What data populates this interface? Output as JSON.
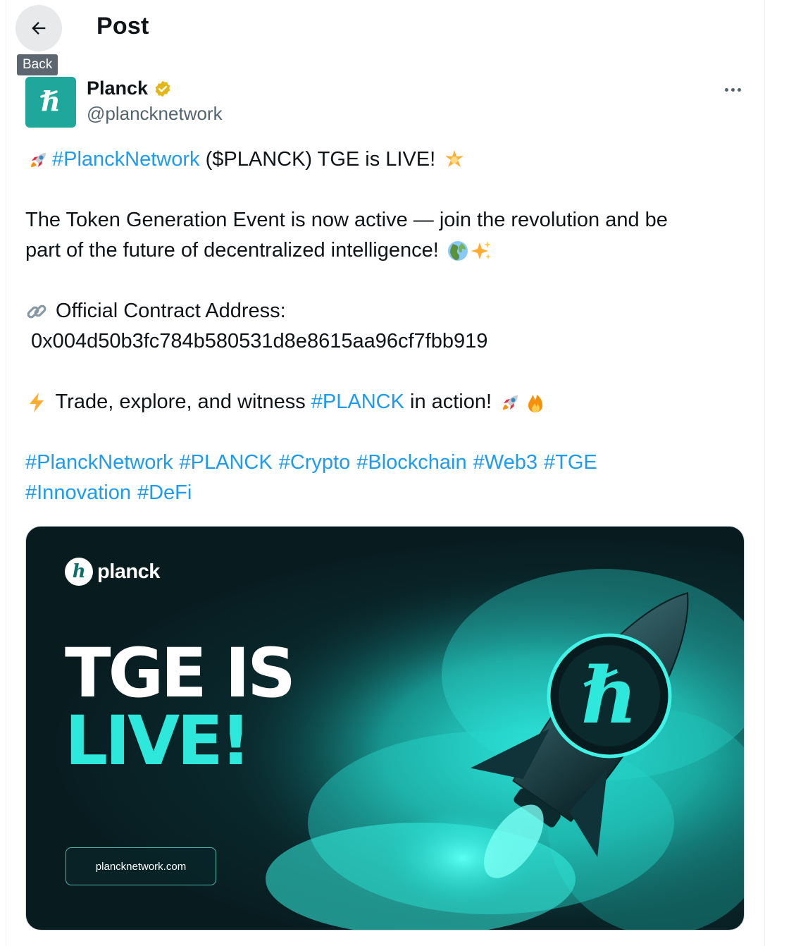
{
  "header": {
    "title": "Post",
    "back_tooltip": "Back"
  },
  "author": {
    "name": "Planck",
    "handle": "@plancknetwork",
    "verified": true,
    "avatar_glyph": "h",
    "avatar_color": "#1ea79a"
  },
  "post": {
    "line1": {
      "tag": "#PlanckNetwork",
      "text": " ($PLANCK) TGE is LIVE! "
    },
    "line2": "The Token Generation Event is now active — join the revolution and be",
    "line3": "part of the future of decentralized intelligence! ",
    "line4": " Official Contract Address:",
    "line5": " 0x004d50b3fc784b580531d8e8615aa96cf7fbb919",
    "line6": {
      "text_before": " Trade, explore, and witness ",
      "tag": "#PLANCK",
      "text_after": " in action! "
    },
    "hashtags_row1": [
      "#PlanckNetwork",
      "#PLANCK",
      "#Crypto",
      "#Blockchain",
      "#Web3",
      "#TGE"
    ],
    "hashtags_row2": [
      "#Innovation",
      "#DeFi"
    ],
    "emoji_icons": [
      "rocket-icon",
      "glowing-star-icon",
      "globe-icon",
      "sparkles-icon",
      "link-icon",
      "lightning-icon",
      "rocket-icon",
      "fire-icon"
    ]
  },
  "media": {
    "logo_text": "planck",
    "logo_glyph": "h",
    "headline_line1": "TGE IS",
    "headline_line2": "LIVE!",
    "url": "plancknetwork.com",
    "rocket_glyph": "ℏ",
    "accent_color": "#2ee8dc"
  },
  "colors": {
    "link": "#1d9bf0",
    "text": "#0f1419",
    "secondary": "#536471",
    "verified": "#e2b719"
  }
}
